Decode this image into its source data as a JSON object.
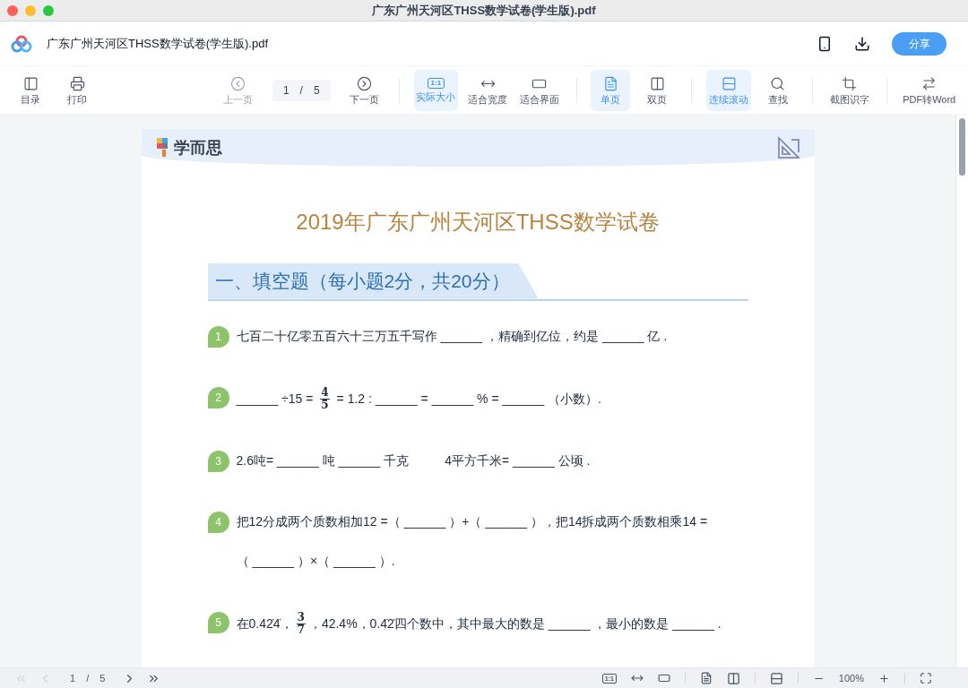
{
  "window": {
    "title": "广东广州天河区THSS数学试卷(学生版).pdf"
  },
  "header": {
    "file_name": "广东广州天河区THSS数学试卷(学生版).pdf",
    "share": "分享"
  },
  "toolbar": [
    {
      "kind": "toc",
      "label": "目录",
      "selected": false,
      "disabled": false
    },
    {
      "kind": "print",
      "label": "打印",
      "selected": false,
      "disabled": false
    },
    {
      "kind": "prev",
      "label": "上一页",
      "selected": false,
      "disabled": true
    },
    {
      "kind": "pager",
      "current": "1",
      "sep": "/",
      "total": "5"
    },
    {
      "kind": "next",
      "label": "下一页",
      "selected": false,
      "disabled": false
    },
    {
      "kind": "sep"
    },
    {
      "kind": "actual",
      "label": "实际大小",
      "badge": "1:1",
      "selected": true,
      "disabled": false
    },
    {
      "kind": "fitwidth",
      "label": "适合宽度",
      "selected": false,
      "disabled": false
    },
    {
      "kind": "fitpage",
      "label": "适合界面",
      "selected": false,
      "disabled": false
    },
    {
      "kind": "sep"
    },
    {
      "kind": "single",
      "label": "单页",
      "selected": true,
      "disabled": false
    },
    {
      "kind": "double",
      "label": "双页",
      "selected": false,
      "disabled": false
    },
    {
      "kind": "sep"
    },
    {
      "kind": "scroll",
      "label": "连续滚动",
      "selected": true,
      "disabled": false
    },
    {
      "kind": "find",
      "label": "查找",
      "selected": false,
      "disabled": false
    },
    {
      "kind": "sep"
    },
    {
      "kind": "ocr",
      "label": "截图识字",
      "selected": false,
      "disabled": false
    },
    {
      "kind": "sep"
    },
    {
      "kind": "convert",
      "label": "PDF转Word",
      "selected": false,
      "disabled": false
    }
  ],
  "document": {
    "brand": "学而思",
    "title": "2019年广东广州天河区THSS数学试卷",
    "section": "一、填空题（每小题2分，共20分）",
    "questions": [
      {
        "number": "1",
        "lines": [
          [
            {
              "kind": "text",
              "text": "七百二十亿零五百六十三万五千写作 ______ ，精确到亿位，约是 ______ 亿 ."
            }
          ]
        ]
      },
      {
        "number": "2",
        "lines": [
          [
            {
              "kind": "text",
              "text": "______ ÷15 = "
            },
            {
              "kind": "frac",
              "num": "4",
              "den": "5"
            },
            {
              "kind": "text",
              "text": " = 1.2 : ______ = ______ % = ______ （小数）."
            }
          ]
        ]
      },
      {
        "number": "3",
        "lines": [
          [
            {
              "kind": "text",
              "text": "2.6吨= ______ 吨 ______ 千克"
            },
            {
              "kind": "gap"
            },
            {
              "kind": "text",
              "text": "4平方千米= ______ 公顷 ."
            }
          ]
        ]
      },
      {
        "number": "4",
        "lines": [
          [
            {
              "kind": "text",
              "text": "把12分成两个质数相加12 =（ ______ ）+（ ______ ），把14拆成两个质数相乘14 ="
            }
          ],
          [
            {
              "kind": "text",
              "text": "（ ______ ）×（ ______ ）."
            }
          ]
        ]
      },
      {
        "number": "5",
        "lines": [
          [
            {
              "kind": "text",
              "text": "在0.42̇4̇，"
            },
            {
              "kind": "frac",
              "num": "3",
              "den": "7"
            },
            {
              "kind": "text",
              "text": "，42.4%，0.4̇2̇四个数中，其中最大的数是 ______ ，最小的数是 ______ ."
            }
          ]
        ]
      }
    ]
  },
  "status_bar": {
    "current": "1",
    "sep": "/",
    "total": "5",
    "badge": "1:1",
    "zoom": "100%"
  }
}
